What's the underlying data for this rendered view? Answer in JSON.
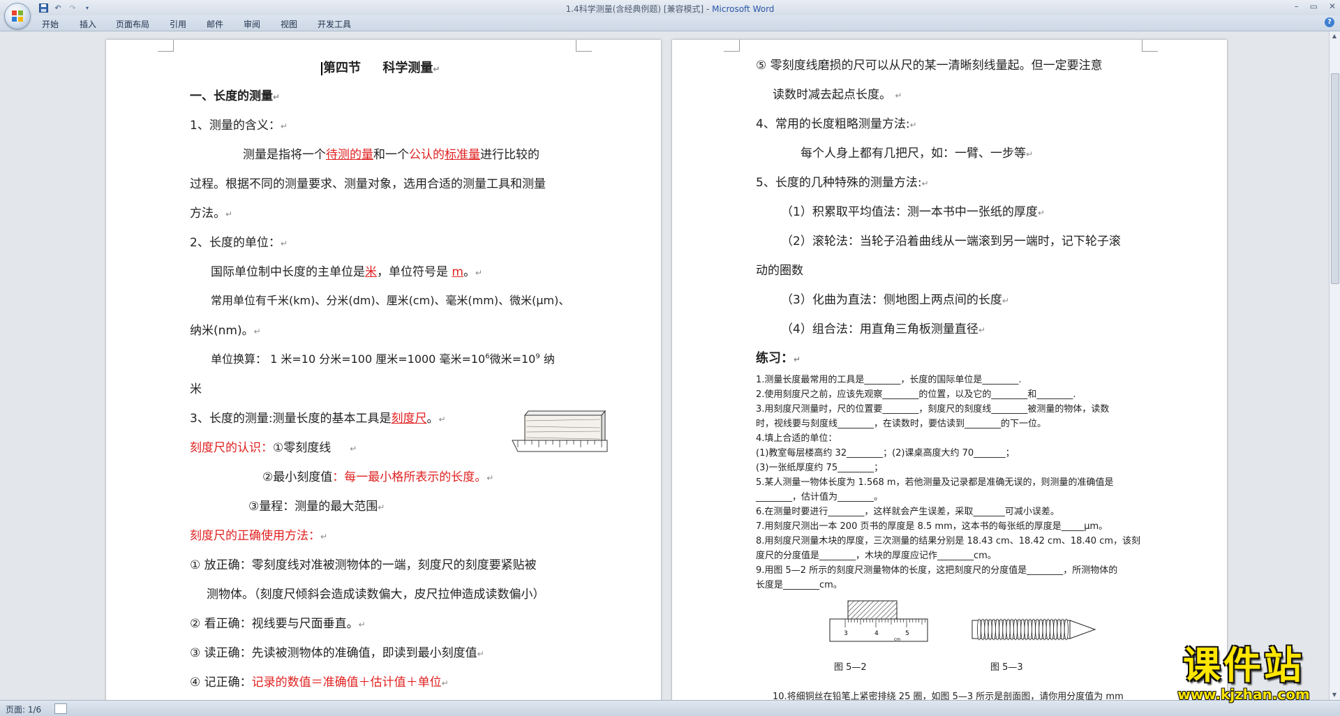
{
  "window": {
    "doc_title": "1.4科学测量(含经典例题) [兼容模式] - ",
    "app_name": "Microsoft Word",
    "controls": [
      "–",
      "▭",
      "✕"
    ]
  },
  "qat": {
    "icons": [
      "save-icon",
      "undo-icon",
      "redo-icon",
      "customize-icon"
    ]
  },
  "ribbon": {
    "tabs": [
      "开始",
      "插入",
      "页面布局",
      "引用",
      "邮件",
      "审阅",
      "视图",
      "开发工具"
    ],
    "help": "?"
  },
  "page1": {
    "title_a": "第四节",
    "title_b": "科学测量",
    "h1": "一、长度的测量",
    "l1": "1、测量的含义：",
    "l2a": "测量是指将一个",
    "l2b": "待测的量",
    "l2c": "和一个",
    "l2d": "公认的",
    "l2e": "标准量",
    "l2f": "进行比较的",
    "l3": "过程。根据不同的测量要求、测量对象，选用合适的测量工具和测量",
    "l4": "方法。",
    "l5": "2、长度的单位：",
    "l6a": "国际单位制中长度的主单位是",
    "l6b": "米",
    "l6c": "，单位符号是 ",
    "l6d": "m",
    "l6e": "。",
    "l7": "常用单位有千米(km)、分米(dm)、厘米(cm)、毫米(mm)、微米(μm)、",
    "l8": "纳米(nm)。",
    "l9a": "单位换算：   1 米=10 分米=100 厘米=1000 毫米=10",
    "l9b": "6",
    "l9c": "微米=10",
    "l9d": "9",
    "l9e": " 纳",
    "l10": "米",
    "l11a": "3、长度的测量:测量长度的基本工具是",
    "l11b": "刻度尺",
    "l11c": "。",
    "l12a": "刻度尺的认识：",
    "l12b": "①零刻度线",
    "l13a": "②最小刻度值",
    "l13b": "：每一最小格所表示的长度。",
    "l14": "③量程：测量的最大范围",
    "l15": "刻度尺的正确使用方法：",
    "l16": "① 放正确：零刻度线对准被测物体的一端，刻度尺的刻度要紧贴被",
    "l17": "测物体。（刻度尺倾斜会造成读数偏大，皮尺拉伸造成读数偏小）",
    "l18": "② 看正确：视线要与尺面垂直。",
    "l19": "③ 读正确：先读被测物体的准确值，即读到最小刻度值",
    "l20a": "④ 记正确：",
    "l20b": "记录的数值＝准确值＋估计值＋单位"
  },
  "page2": {
    "l1": "⑤ 零刻度线磨损的尺可以从尺的某一清晰刻线量起。但一定要注意",
    "l2": "读数时减去起点长度。",
    "l3": "4、常用的长度粗略测量方法:",
    "l4": "每个人身上都有几把尺，如：一臂、一步等",
    "l5": "5、长度的几种特殊的测量方法:",
    "l6": "（1）积累取平均值法：测一本书中一张纸的厚度",
    "l7": "（2）滚轮法：当轮子沿着曲线从一端滚到另一端时，记下轮子滚",
    "l8": "动的圈数",
    "l9": "（3）化曲为直法：侧地图上两点间的长度",
    "l10": "（4）组合法：用直角三角板测量直径",
    "ex_title": "练习：",
    "q1": "1.测量长度最常用的工具是________，长度的国际单位是________.",
    "q2": "2.使用刻度尺之前，应该先观察________的位置，以及它的________和________.",
    "q3a": "3.用刻度尺测量时，尺的位置要________，刻度尺的刻度线________被测量的物体，读数",
    "q3b": "时，视线要与刻度线________，在读数时，要估读到________的下一位。",
    "q4": "4.填上合适的单位：",
    "q4a": "(1)教室每层楼高约 32________；(2)课桌高度大约 70_______；",
    "q4b": "(3)一张纸厚度约 75________；",
    "q5a": "5.某人测量一物体长度为  1.568  m，若他测量及记录都是准确无误的，则测量的准确值是",
    "q5b": "________，估计值为________。",
    "q6": "6.在测量时要进行________，这样就会产生误差，采取_______可减小误差。",
    "q7": "7.用刻度尺测出一本 200 页书的厚度是 8.5 mm，这本书的每张纸的厚度是_____μm。",
    "q8a": "8.用刻度尺测量木块的厚度，三次测量的结果分别是 18.43 cm、18.42 cm、18.40 cm，该刻",
    "q8b": "度尺的分度值是________，木块的厚度应记作________cm。",
    "q9a": "9.用图 5—2 所示的刻度尺测量物体的长度，这把刻度尺的分度值是________，所测物体的",
    "q9b": "长度是________cm。",
    "fig52": "图 5—2",
    "fig53": "图 5—3",
    "ruler_ticks": [
      "3",
      "4",
      "5"
    ],
    "ruler_unit": "cm",
    "q10": "10.将细铜丝在铅笔上紧密排绕 25 圈，如图 5—3 所示是剖面图，请你用分度值为 mm"
  },
  "status": {
    "page_info": "页面: 1/6"
  },
  "watermark": {
    "text": "课件站",
    "url": "www.kjzhan.com"
  }
}
